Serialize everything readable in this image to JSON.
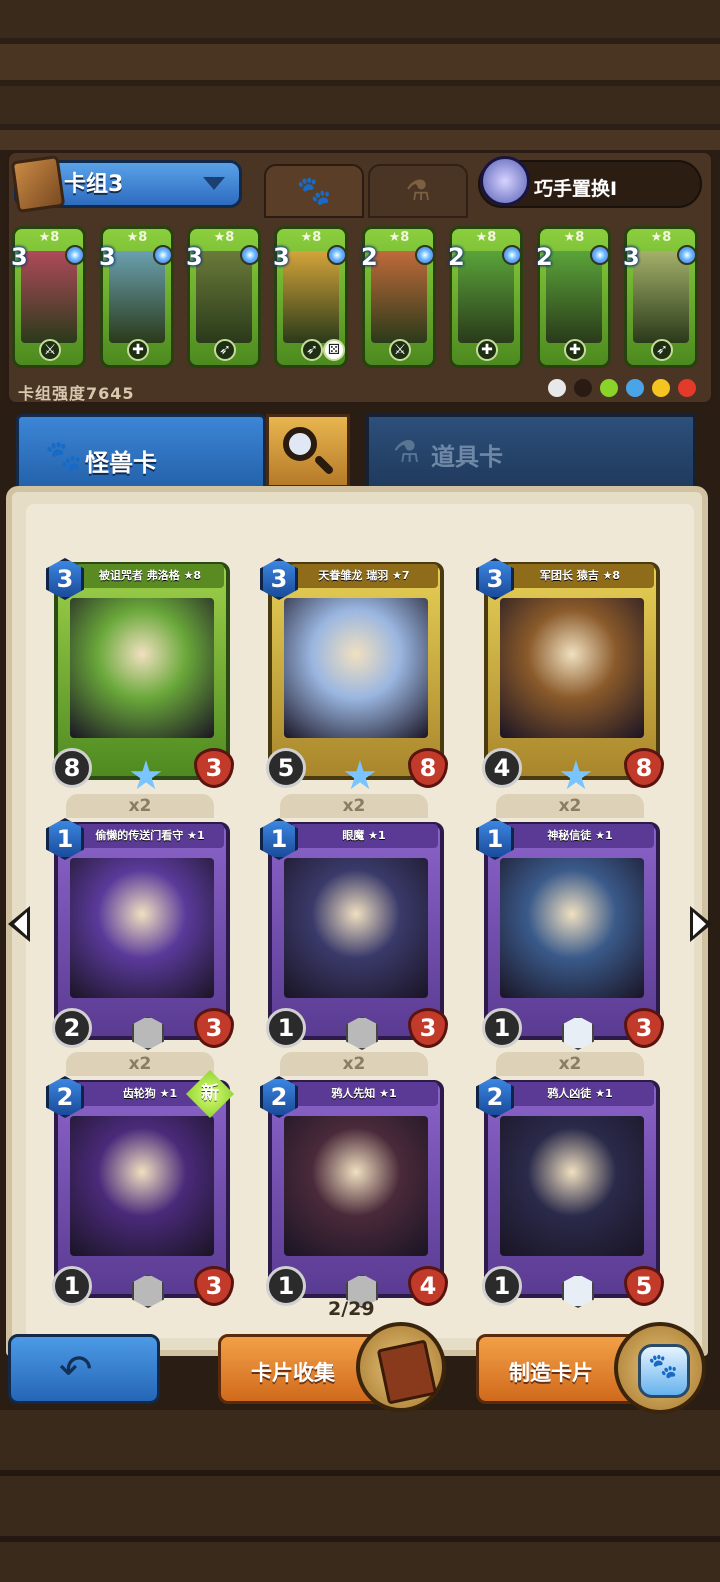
{
  "deck": {
    "name": "卡组3",
    "power": "卡组强度7645",
    "swap_label": "巧手置换I"
  },
  "tabs": {
    "paw_icon": "paw-icon",
    "potion_icon": "potion-icon"
  },
  "deck_cards": [
    {
      "star": "★8",
      "cost": "3",
      "ability": "sword-icon",
      "ability2": "",
      "art": "#b04a5a"
    },
    {
      "star": "★8",
      "cost": "3",
      "ability": "heal-icon",
      "ability2": "",
      "art": "#6aa0b0"
    },
    {
      "star": "★8",
      "cost": "3",
      "ability": "bow-icon",
      "ability2": "",
      "art": "#6a7a3a"
    },
    {
      "star": "★8",
      "cost": "3",
      "ability": "bow-icon",
      "ability2": "dice-icon",
      "art": "#d4a43a"
    },
    {
      "star": "★8",
      "cost": "2",
      "ability": "sword-icon",
      "ability2": "",
      "art": "#c06a3a"
    },
    {
      "star": "★8",
      "cost": "2",
      "ability": "heal-icon",
      "ability2": "",
      "art": "#5aa43a"
    },
    {
      "star": "★8",
      "cost": "2",
      "ability": "heal-icon",
      "ability2": "",
      "art": "#5aa43a"
    },
    {
      "star": "★8",
      "cost": "3",
      "ability": "bow-icon",
      "ability2": "",
      "art": "#a4b06a"
    }
  ],
  "elements": [
    "#e8e8e8",
    "#2a1a14",
    "#8ad42a",
    "#4aa4e8",
    "#f4c420",
    "#e43a2a"
  ],
  "categories": {
    "monster": "怪兽卡",
    "item": "道具卡"
  },
  "cards": [
    {
      "name": "被诅咒者 弗洛格 ★8",
      "cost": "3",
      "atk": "8",
      "hp": "3",
      "frame": "green",
      "art": "#6aa83a",
      "copies": "",
      "new": false
    },
    {
      "name": "天眷雏龙 瑞羽 ★7",
      "cost": "3",
      "atk": "5",
      "hp": "8",
      "frame": "gold",
      "art": "#9ab6e0",
      "copies": "",
      "new": false
    },
    {
      "name": "军团长 猿吉 ★8",
      "cost": "3",
      "atk": "4",
      "hp": "8",
      "frame": "gold",
      "art": "#8a5a2a",
      "copies": "",
      "new": false
    },
    {
      "name": "偷懒的传送门看守 ★1",
      "cost": "1",
      "atk": "2",
      "hp": "3",
      "frame": "purple",
      "art": "#5a3a9a",
      "copies": "x2",
      "new": false
    },
    {
      "name": "眼魔 ★1",
      "cost": "1",
      "atk": "1",
      "hp": "3",
      "frame": "purple",
      "art": "#3a3a6a",
      "copies": "x2",
      "new": false
    },
    {
      "name": "神秘信徒 ★1",
      "cost": "1",
      "atk": "1",
      "hp": "3",
      "frame": "purple",
      "art": "#3a5a8a",
      "copies": "x2",
      "new": false
    },
    {
      "name": "齿轮狗 ★1",
      "cost": "2",
      "atk": "1",
      "hp": "3",
      "frame": "purple",
      "art": "#4a2a7a",
      "copies": "x2",
      "new": true
    },
    {
      "name": "鸦人先知 ★1",
      "cost": "2",
      "atk": "1",
      "hp": "4",
      "frame": "purple",
      "art": "#4a2a3a",
      "copies": "x2",
      "new": false
    },
    {
      "name": "鸦人凶徒 ★1",
      "cost": "2",
      "atk": "1",
      "hp": "5",
      "frame": "purple",
      "art": "#2a2a4a",
      "copies": "x2",
      "new": false
    }
  ],
  "new_label": "新",
  "pager": "2/29",
  "buttons": {
    "back_icon": "back-arrow-icon",
    "collect": "卡片收集",
    "craft": "制造卡片"
  }
}
